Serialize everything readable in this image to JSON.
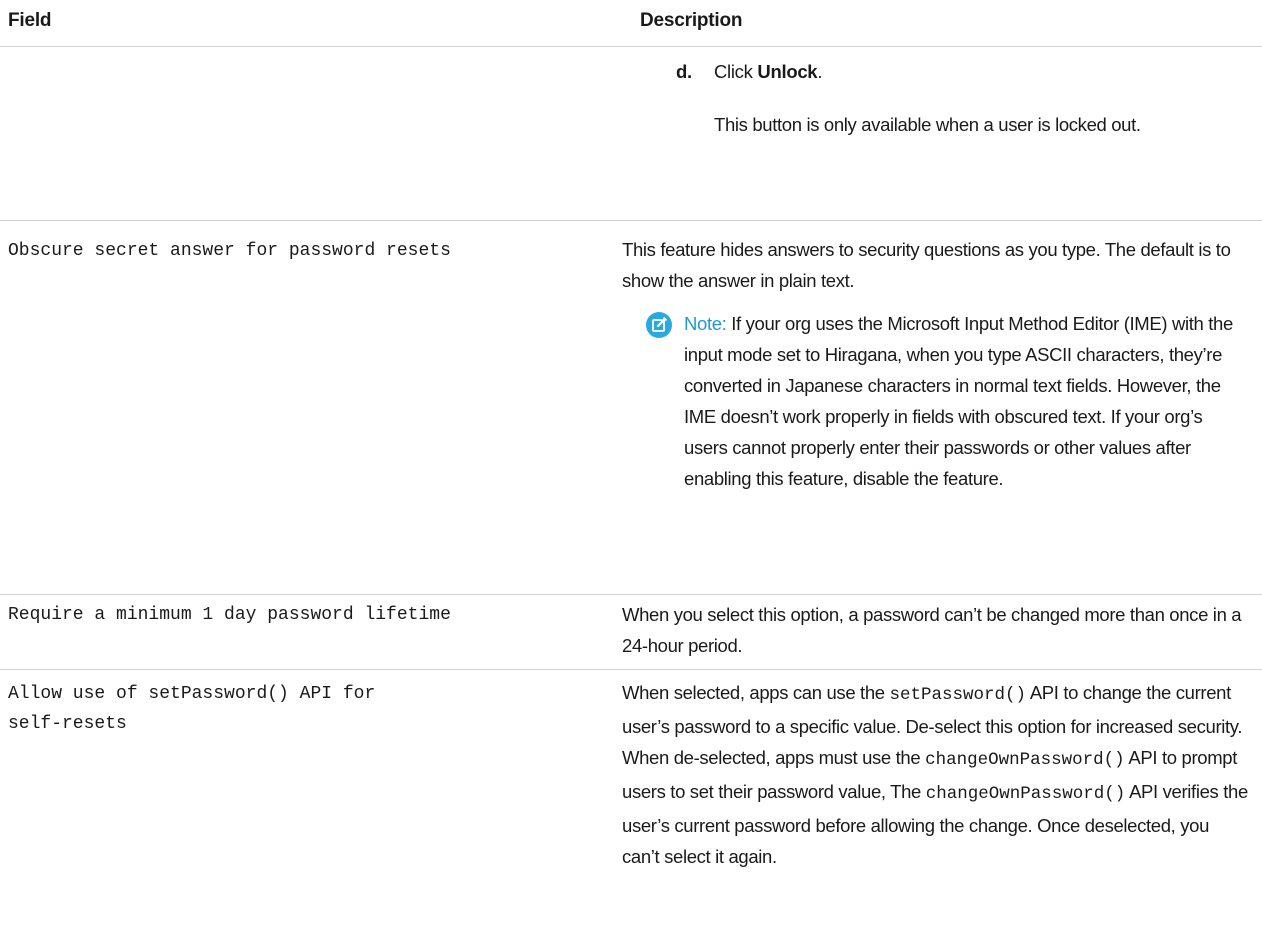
{
  "header": {
    "field": "Field",
    "description": "Description"
  },
  "row_unlock": {
    "step_letter": "d.",
    "step_prefix": "Click ",
    "step_bold": "Unlock",
    "step_suffix": ".",
    "step_note": "This button is only available when a user is locked out."
  },
  "row_obscure": {
    "field": "Obscure secret answer for password resets",
    "description": "This feature hides answers to security questions as you type. The default is to show the answer in plain text.",
    "note_icon": "edit-note-icon",
    "note_label": "Note:",
    "note_text": " If your org uses the Microsoft Input Method Editor (IME) with the input mode set to Hiragana, when you type ASCII characters, they’re converted in Japanese characters in normal text fields. However, the IME doesn’t work properly in fields with obscured text. If your org’s users cannot properly enter their passwords or other values after enabling this feature, disable the feature."
  },
  "row_lifetime": {
    "field": "Require a minimum 1 day password lifetime",
    "description": "When you select this option, a password can’t be changed more than once in a 24-hour period."
  },
  "row_setpassword": {
    "field": "Allow use of setPassword() API for\nself-resets",
    "desc_part1": "When selected, apps can use the ",
    "code1": "setPassword()",
    "desc_part2": " API to change the current user’s password to a specific value. De-select this option for increased security. When de-selected, apps must use the ",
    "code2": "changeOwnPassword()",
    "desc_part3": " API to prompt users to set their password value, The ",
    "code3": "changeOwnPassword()",
    "desc_part4": " API verifies the user’s current password before allowing the change. Once deselected, you can’t select it again."
  },
  "colors": {
    "note_accent": "#1d9ad6",
    "icon_bg": "#2aa9e0",
    "rule": "#d0d0d0"
  }
}
